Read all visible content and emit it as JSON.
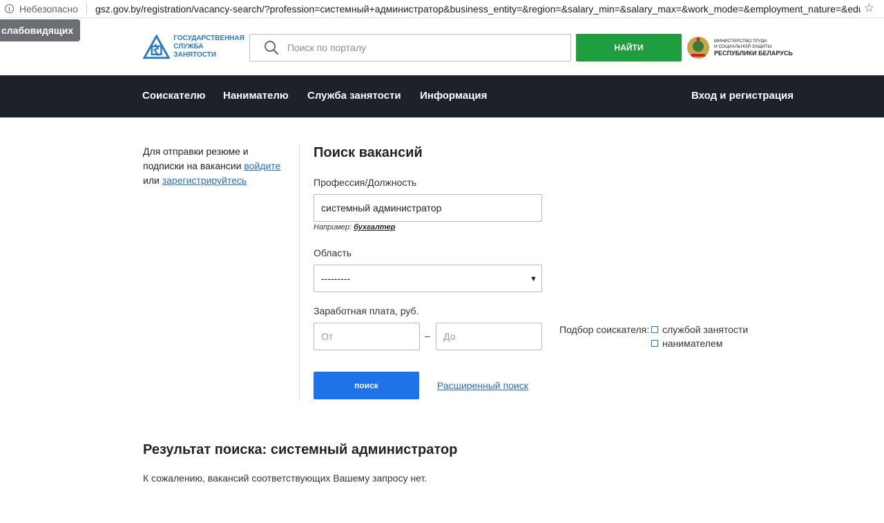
{
  "browser": {
    "insecure_label": "Небезопасно",
    "url": "gsz.gov.by/registration/vacancy-search/?profession=системный+администратор&business_entity=&region=&salary_min=&salary_max=&work_mode=&employment_nature=&educati..."
  },
  "accessibility": {
    "low_vision_label": "слабовидящих"
  },
  "header": {
    "logo_line1": "Государственная",
    "logo_line2": "служба занятости",
    "search_placeholder": "Поиск по порталу",
    "find_label": "Найти",
    "ministry_line1": "Министерство труда",
    "ministry_line2": "и социальной защиты",
    "ministry_line3": "Республики Беларусь"
  },
  "nav": {
    "items": [
      "Соискателю",
      "Нанимателю",
      "Служба занятости",
      "Информация"
    ],
    "login_label": "Вход и регистрация"
  },
  "sidebar": {
    "text_part1": "Для отправки резюме и подписки на вакансии ",
    "login_link": "войдите",
    "text_part2": " или ",
    "register_link": "зарегистрируйтесь"
  },
  "form": {
    "title": "Поиск вакансий",
    "profession_label": "Профессия/Должность",
    "profession_value": "системный администратор",
    "example_prefix": "Например: ",
    "example_value": "бухгалтер",
    "region_label": "Область",
    "region_value": "---------",
    "salary_label": "Заработная плата, руб.",
    "salary_from_placeholder": "От",
    "salary_to_placeholder": "До",
    "salary_dash": "–",
    "picker_label": "Подбор соискателя:",
    "picker_options": [
      "службой занятости",
      "нанимателем"
    ],
    "submit_label": "поиск",
    "advanced_link": "Расширенный поиск"
  },
  "results": {
    "title": "Результат поиска: системный администратор",
    "empty_text": "К сожалению, вакансий соответствующих Вашему запросу нет."
  },
  "colors": {
    "nav_bg": "#1d2228",
    "find_button": "#1e9e3e",
    "submit_button": "#1e73e8",
    "link": "#2b6cc4",
    "logo_blue": "#2a7bbf"
  }
}
